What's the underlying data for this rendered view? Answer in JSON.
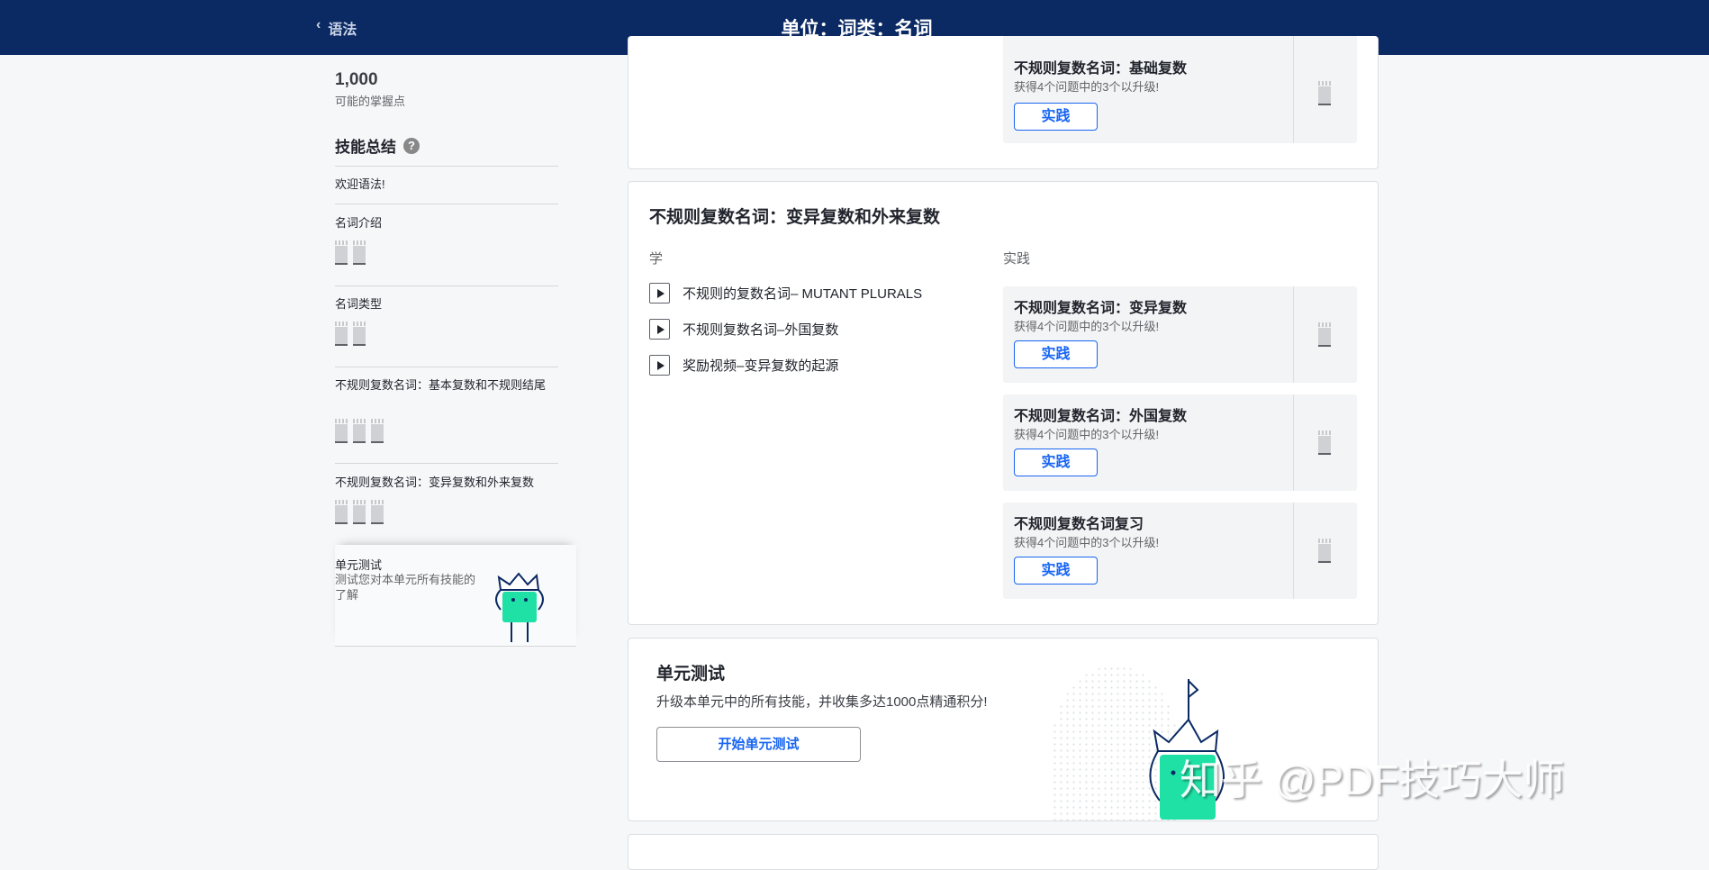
{
  "header": {
    "back_label": "语法",
    "title": "单位：词类：名词"
  },
  "sidebar": {
    "points": "1,000",
    "points_label": "可能的掌握点",
    "summary_title": "技能总结",
    "items": [
      {
        "label": "欢迎语法!"
      },
      {
        "label": "名词介绍"
      },
      {
        "label": "名词类型"
      },
      {
        "label": "不规则复数名词：基本复数和不规则结尾"
      },
      {
        "label": "不规则复数名词：变异复数和外来复数"
      }
    ],
    "unit_test": {
      "title": "单元测试",
      "desc": "测试您对本单元所有技能的了解"
    }
  },
  "card1": {
    "practice": {
      "title": "不规则复数名词：基础复数",
      "subtitle": "获得4个问题中的3个以升级!",
      "button": "实践"
    }
  },
  "card2": {
    "title": "不规则复数名词：变异复数和外来复数",
    "learn_label": "学",
    "practice_label": "实践",
    "videos": [
      {
        "label": "不规则的复数名词– MUTANT PLURALS"
      },
      {
        "label": "不规则复数名词–外国复数"
      },
      {
        "label": "奖励视频–变异复数的起源"
      }
    ],
    "practice": [
      {
        "title": "不规则复数名词：变异复数",
        "subtitle": "获得4个问题中的3个以升级!",
        "button": "实践"
      },
      {
        "title": "不规则复数名词：外国复数",
        "subtitle": "获得4个问题中的3个以升级!",
        "button": "实践"
      },
      {
        "title": "不规则复数名词复习",
        "subtitle": "获得4个问题中的3个以升级!",
        "button": "实践"
      }
    ]
  },
  "unit_test_card": {
    "title": "单元测试",
    "desc": "升级本单元中的所有技能，并收集多达1000点精通积分!",
    "button": "开始单元测试"
  },
  "watermark": "知乎 @PDF技巧大师",
  "colors": {
    "header": "#0b2a63",
    "accent": "#1865f2",
    "mascot": "#1fe0a5"
  }
}
